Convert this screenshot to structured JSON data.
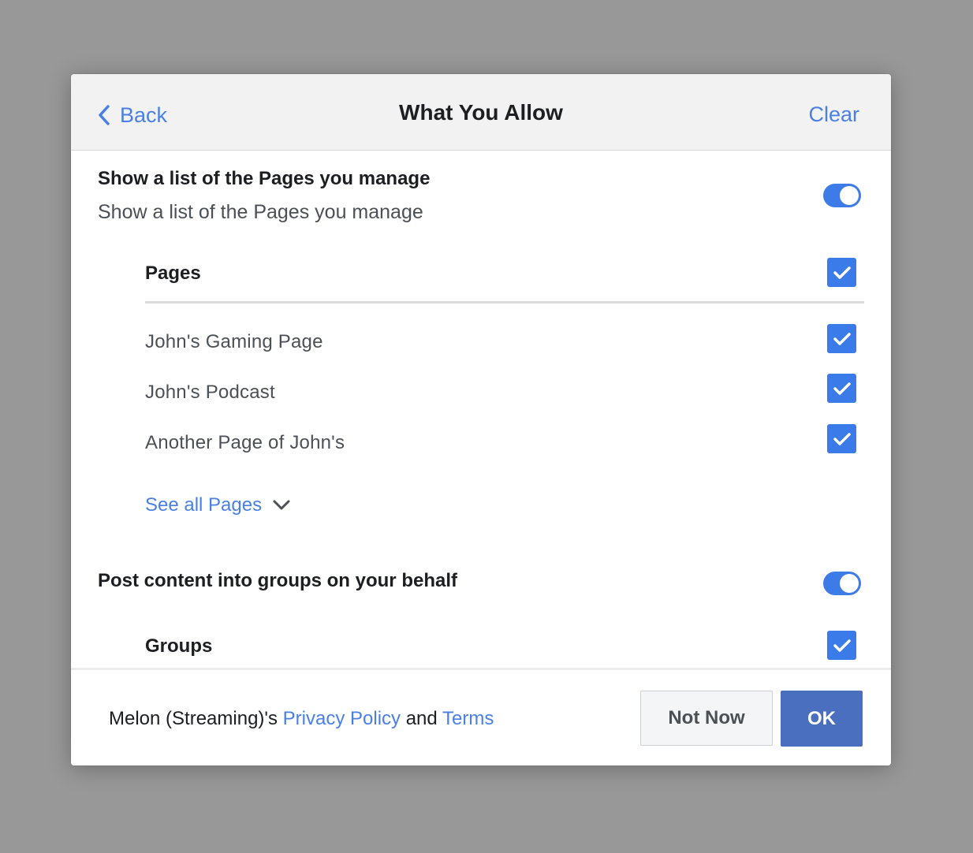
{
  "header": {
    "back_label": "Back",
    "title": "What You Allow",
    "clear_label": "Clear"
  },
  "sections": {
    "pages_permission": {
      "title": "Show a list of the Pages you manage",
      "description": "Show a list of the Pages you manage",
      "toggle_on": true,
      "list_header": "Pages",
      "items": [
        {
          "label": "John's Gaming Page",
          "checked": true
        },
        {
          "label": "John's Podcast",
          "checked": true
        },
        {
          "label": "Another Page of John's",
          "checked": true
        }
      ],
      "see_all_label": "See all Pages"
    },
    "groups_permission": {
      "title": "Post content into groups on your behalf",
      "toggle_on": true,
      "list_header": "Groups"
    }
  },
  "footer": {
    "prefix": "Melon (Streaming)'s ",
    "privacy_label": "Privacy Policy",
    "and_text": " and ",
    "terms_label": "Terms",
    "not_now_label": "Not Now",
    "ok_label": "OK"
  },
  "colors": {
    "accent": "#4a80e6",
    "toggle": "#3d7be8",
    "checkbox": "#3b7be9",
    "ok_button": "#4a6fbe",
    "backdrop": "#989898"
  },
  "icons": {
    "back": "chevron-left-icon",
    "see_all": "chevron-down-icon",
    "check": "checkmark-icon"
  }
}
